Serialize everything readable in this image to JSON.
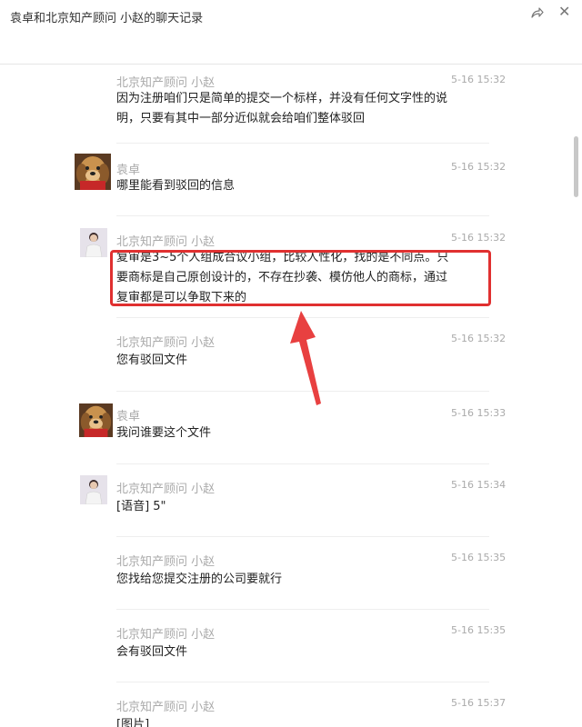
{
  "window": {
    "title": "袁卓和北京知产顾问 小赵的聊天记录"
  },
  "messages": [
    {
      "sender": "北京知产顾问 小赵",
      "time": "5-16 15:32",
      "text": "因为注册咱们只是简单的提交一个标样，并没有任何文字性的说\n明，只要有其中一部分近似就会给咱们整体驳回",
      "avatar": "none"
    },
    {
      "sender": "袁卓",
      "time": "5-16 15:32",
      "text": "哪里能看到驳回的信息",
      "avatar": "dog"
    },
    {
      "sender": "北京知产顾问 小赵",
      "time": "5-16 15:32",
      "text": "复审是3~5个人组成合议小组，比较人性化，找的是不同点。只\n要商标是自己原创设计的，不存在抄袭、模仿他人的商标，通过\n复审都是可以争取下来的",
      "avatar": "person"
    },
    {
      "sender": "北京知产顾问 小赵",
      "time": "5-16 15:32",
      "text": "您有驳回文件",
      "avatar": "none"
    },
    {
      "sender": "袁卓",
      "time": "5-16 15:33",
      "text": "我问谁要这个文件",
      "avatar": "dog"
    },
    {
      "sender": "北京知产顾问 小赵",
      "time": "5-16 15:34",
      "text": "[语音] 5\"",
      "avatar": "person"
    },
    {
      "sender": "北京知产顾问 小赵",
      "time": "5-16 15:35",
      "text": "您找给您提交注册的公司要就行",
      "avatar": "none"
    },
    {
      "sender": "北京知产顾问 小赵",
      "time": "5-16 15:35",
      "text": "会有驳回文件",
      "avatar": "none"
    },
    {
      "sender": "北京知产顾问 小赵",
      "time": "5-16 15:37",
      "text": "[图片]",
      "avatar": "none"
    }
  ],
  "colors": {
    "highlight": "#e03030",
    "sender": "#aaaaaa"
  }
}
